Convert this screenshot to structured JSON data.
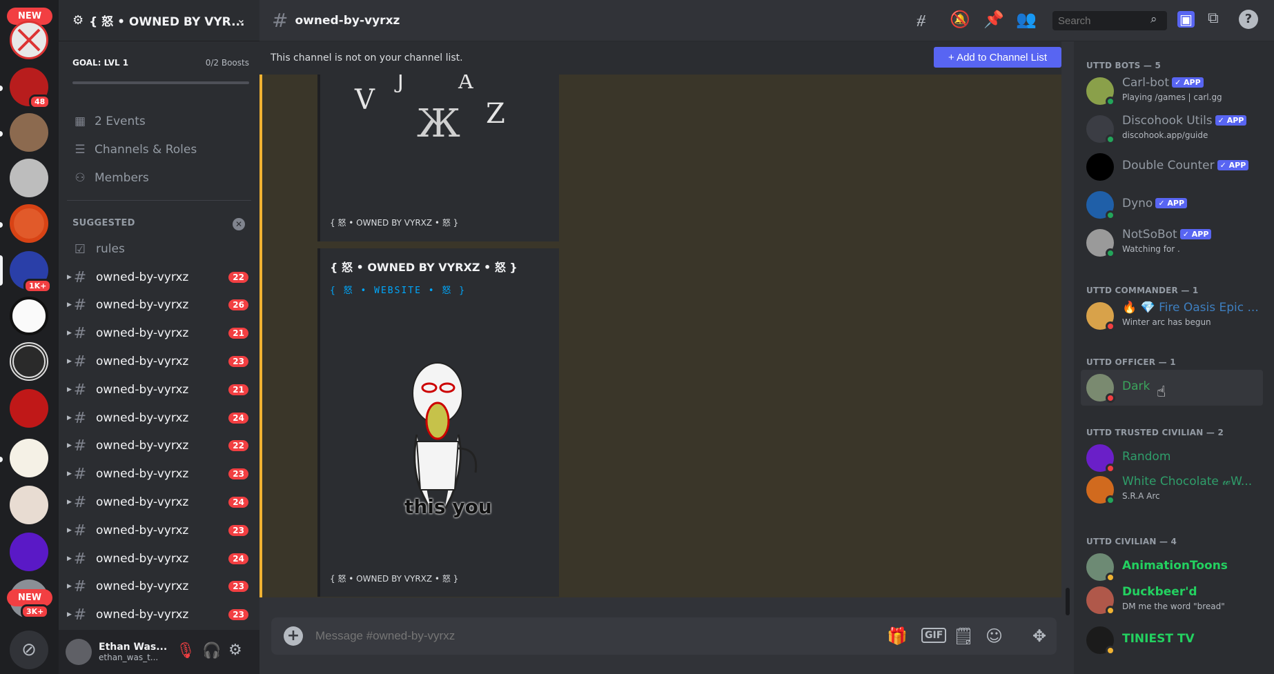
{
  "rail": {
    "new_top": "NEW",
    "new_bottom": "NEW",
    "badges": [
      "48",
      "1K+",
      "3K+"
    ]
  },
  "sidebar": {
    "server_name": "{ 怒 • OWNED BY VYR...",
    "boost_goal": "GOAL: LVL 1",
    "boost_count": "0/2 Boosts",
    "nav": [
      {
        "label": "2 Events",
        "icon": "calendar-icon"
      },
      {
        "label": "Channels & Roles",
        "icon": "list-icon"
      },
      {
        "label": "Members",
        "icon": "members-icon"
      }
    ],
    "suggested_label": "SUGGESTED",
    "rules_label": "rules",
    "channels": [
      {
        "name": "owned-by-vyrxz",
        "badge": "22"
      },
      {
        "name": "owned-by-vyrxz",
        "badge": "26"
      },
      {
        "name": "owned-by-vyrxz",
        "badge": "21"
      },
      {
        "name": "owned-by-vyrxz",
        "badge": "23"
      },
      {
        "name": "owned-by-vyrxz",
        "badge": "21"
      },
      {
        "name": "owned-by-vyrxz",
        "badge": "24"
      },
      {
        "name": "owned-by-vyrxz",
        "badge": "22"
      },
      {
        "name": "owned-by-vyrxz",
        "badge": "23"
      },
      {
        "name": "owned-by-vyrxz",
        "badge": "24"
      },
      {
        "name": "owned-by-vyrxz",
        "badge": "23"
      },
      {
        "name": "owned-by-vyrxz",
        "badge": "24"
      },
      {
        "name": "owned-by-vyrxz",
        "badge": "23"
      },
      {
        "name": "owned-by-vyrxz",
        "badge": "23"
      }
    ],
    "user": {
      "name": "Ethan Was...",
      "tag": "ethan_was_t..."
    }
  },
  "topbar": {
    "channel": "owned-by-vyrxz",
    "search_placeholder": "Search"
  },
  "notice": {
    "text": "This channel is not on your channel list.",
    "button": "+ Add to Channel List"
  },
  "messages": {
    "embed1_footer": "{ 怒 • OWNED BY VYRXZ • 怒 }",
    "embed2_title": "{ 怒 • OWNED BY VYRXZ • 怒 }",
    "embed2_link": "{     怒   •   WEBSITE   •   怒     }",
    "embed2_caption": "this you",
    "embed2_footer": "{ 怒 • OWNED BY VYRXZ • 怒 }"
  },
  "composer": {
    "placeholder": "Message #owned-by-vyrxz"
  },
  "members": {
    "groups": [
      {
        "label": "UTTD BOTS — 5"
      },
      {
        "label": "UTTD COMMANDER — 1"
      },
      {
        "label": "UTTD OFFICER — 1"
      },
      {
        "label": "UTTD TRUSTED CIVILIAN — 2"
      },
      {
        "label": "UTTD CIVILIAN — 4"
      }
    ],
    "list": [
      {
        "name": "Carl-bot",
        "status": "Playing /games | carl.gg",
        "app": "✓ APP",
        "color": "#949ba4"
      },
      {
        "name": "Discohook Utils",
        "status": "discohook.app/guide",
        "app": "✓ APP",
        "color": "#949ba4"
      },
      {
        "name": "Double Counter",
        "status": "",
        "app": "✓ APP",
        "color": "#949ba4"
      },
      {
        "name": "Dyno",
        "status": "",
        "app": "✓ APP",
        "color": "#949ba4"
      },
      {
        "name": "NotSoBot",
        "status": "Watching for .",
        "app": "✓ APP",
        "color": "#949ba4"
      },
      {
        "name": "🔥 💎 Fire Oasis Epic ...",
        "status": "Winter arc has begun",
        "app": "",
        "color": "#3e7fc0"
      },
      {
        "name": "Dark",
        "status": "",
        "app": "",
        "color": "#3ba55c"
      },
      {
        "name": "Random",
        "status": "",
        "app": "",
        "color": "#2f9e6a"
      },
      {
        "name": "White Chocolate 𝓌W...",
        "status": "S.R.A Arc",
        "app": "",
        "color": "#2f9e6a"
      },
      {
        "name": "AnimationToons",
        "status": "",
        "app": "",
        "color": "#23d160"
      },
      {
        "name": "Duckbeer'd",
        "status": "DM me the word \"bread\"",
        "app": "",
        "color": "#23d160"
      },
      {
        "name": "TINIEST TV",
        "status": "",
        "app": "",
        "color": "#23d160"
      }
    ]
  },
  "colors": {
    "accent": "#5865f2",
    "danger": "#f23f42",
    "online": "#23a55a",
    "highlight": "#f0b232"
  }
}
